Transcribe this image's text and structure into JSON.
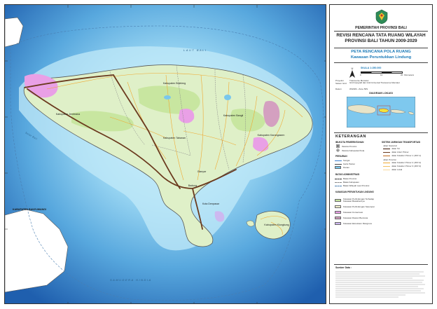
{
  "header": {
    "government": "PEMERINTAH PROVINSI BALI",
    "title": "REVISI RENCANA TATA RUANG WILAYAH PROVINSI BALI TAHUN 2009-2029",
    "map_title": "PETA RENCANA POLA RUANG",
    "map_subtitle": "Kawasan Peruntukkan Lindung"
  },
  "scale": {
    "text": "SKALA 1:250.000",
    "ticks": [
      "0",
      "10",
      "20"
    ],
    "unit": "Kilometers"
  },
  "projection": {
    "labels": [
      "Proyeksi",
      "Sistem Grid",
      "Datum"
    ],
    "values": [
      "Transverse Mercator",
      "Grid Geografi dan Grid Universal Transverse Mercator",
      "WGS84 - Zone 50S"
    ]
  },
  "inset": {
    "title": "DIAGRAM LOKASI"
  },
  "legend": {
    "title": "KETERANGAN",
    "ibukota": {
      "heading": "IBUKOTA PEMERINTAHAN",
      "items": [
        "Ibukota Provinsi",
        "Ibukota Kabupaten/Kota"
      ]
    },
    "perairan": {
      "heading": "PERAIRAN",
      "items": [
        "Sungai",
        "Garis Pantai",
        "Danau"
      ]
    },
    "batas": {
      "heading": "BATAS ADMINISTRASI",
      "items": [
        "Batas Provinsi",
        "Batas Kabupaten",
        "Batas Wilayah Laut Provinsi"
      ]
    },
    "kawasan": {
      "heading": "KAWASAN PERUNTUKAN LINDUNG",
      "items": [
        {
          "label": "Kawasan Perlindungan Terhadap Kawasan Bawahannya",
          "color": "#c8e6a0"
        },
        {
          "label": "Kawasan Perlindungan Setempat",
          "color": "#f4f2d0"
        },
        {
          "label": "Kawasan Konservasi",
          "color": "#e9a0e6"
        },
        {
          "label": "Kawasan Rawan Bencana",
          "color": "#d4a0c0"
        },
        {
          "label": "Kawasan Ekosistem Mangrove",
          "color": "#cdb8f0"
        }
      ]
    },
    "transport": {
      "heading": "SISTEM JARINGAN TRANSPORTASI",
      "nasional_heading": "Jalan Nasional",
      "nasional": [
        "Jalan Tol",
        "Jalan Arteri Primer",
        "Jalan Kolektor Primer 1 (JKP-1)"
      ],
      "provinsi_heading": "Jalan Provinsi",
      "provinsi": [
        "Jalan Kolektor Primer 2 (JKP-2)",
        "Jalan Kolektor Primer 3 (JKP-3)",
        "Jalan Lokal"
      ]
    }
  },
  "source": {
    "heading": "Sumber Data :"
  },
  "map_labels": {
    "sea_north": "LAUT BALI",
    "sea_south": "SAMUDERA HINDIA",
    "strait": "Selat Bali",
    "banyuwangi": "KABUPATEN BANYUWANGI",
    "jembrana": "Kabupaten Jembrana",
    "buleleng": "Kabupaten Buleleng",
    "bangli": "Kabupaten Bangli",
    "karangasem": "Kabupaten Karangasem",
    "tabanan": "Kabupaten Tabanan",
    "badung": "Badung",
    "gianyar": "Gianyar",
    "denpasar": "Kota Denpasar",
    "klungkung": "Kabupaten Klungkung"
  },
  "colors": {
    "deep_sea": "#2f7fc8",
    "shallow_sea": "#9ad6f2",
    "land": "#dff0c8",
    "protected": "#c8e6a0",
    "conservation": "#e9a0e6",
    "road_main": "#6b3a1e",
    "road_minor": "#f0a830",
    "border": "#777777"
  }
}
